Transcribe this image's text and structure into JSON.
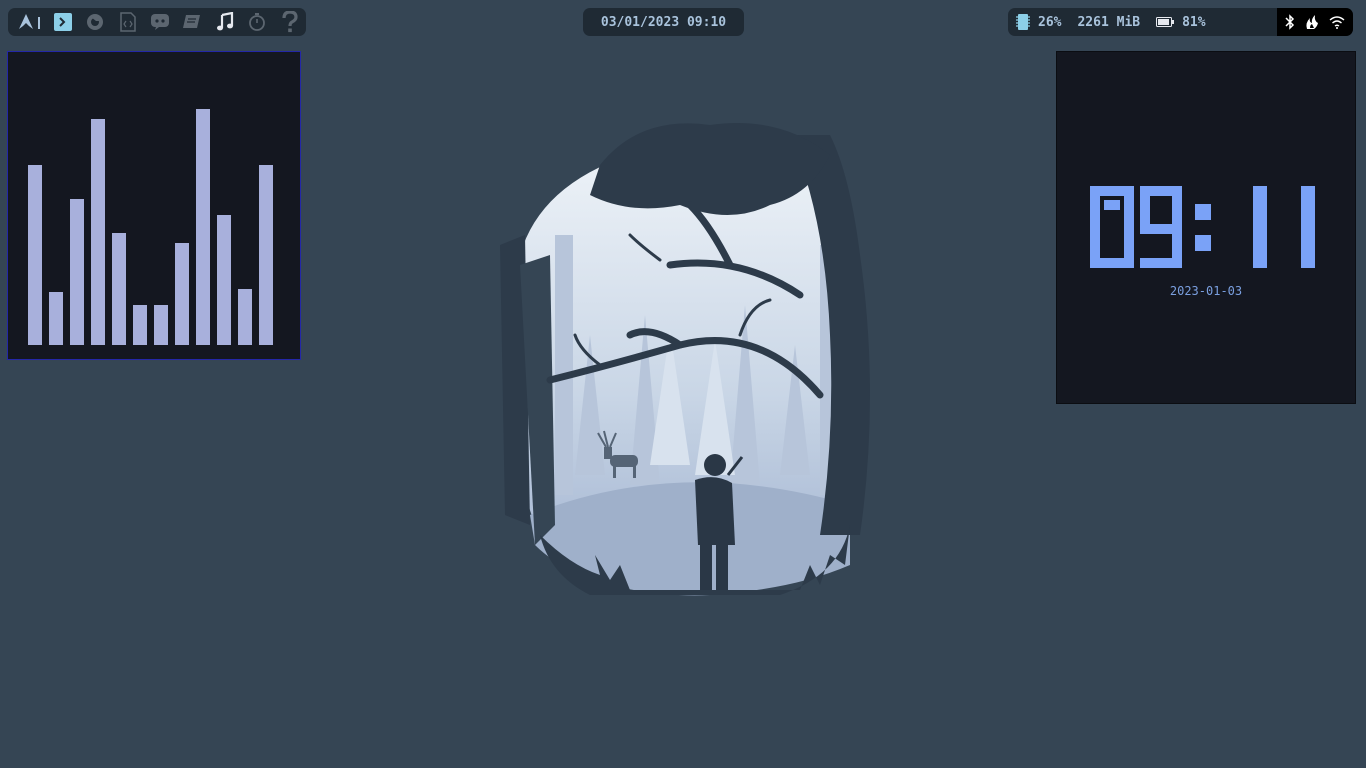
{
  "topbar": {
    "workspaces": [
      {
        "icon": "arch-logo-icon",
        "active": false
      },
      {
        "icon": "terminal-icon",
        "active": true
      },
      {
        "icon": "firefox-icon",
        "active": false
      },
      {
        "icon": "code-file-icon",
        "active": false
      },
      {
        "icon": "discord-icon",
        "active": false
      },
      {
        "icon": "book-icon",
        "active": false
      },
      {
        "icon": "music-note-icon",
        "active": false
      },
      {
        "icon": "stopwatch-icon",
        "active": false
      },
      {
        "icon": "question-mark-icon",
        "active": false
      }
    ],
    "datetime": "03/01/2023 09:10",
    "cpu": "26%",
    "memory": "2261 MiB",
    "battery": "81%",
    "tray_icons": [
      "bluetooth-icon",
      "flame-icon",
      "wifi-icon"
    ]
  },
  "visualizer": {
    "levels": [
      0.58,
      0.17,
      0.47,
      0.73,
      0.36,
      0.13,
      0.13,
      0.33,
      0.76,
      0.42,
      0.18,
      0.58
    ]
  },
  "clock": {
    "time": "09:11",
    "date": "2023-01-03"
  },
  "colors": {
    "background": "#354554",
    "bar_bg": "#1f2a34",
    "accent_text": "#a9c3dc",
    "visualizer_bar": "#a8b0dc",
    "clock_digits": "#7aa2f7",
    "widget_bg": "#141720"
  }
}
